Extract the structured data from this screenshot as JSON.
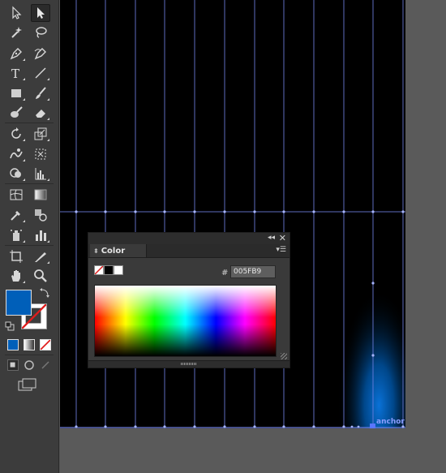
{
  "toolbar": {
    "tools": [
      {
        "name": "selection-tool",
        "selected": false
      },
      {
        "name": "direct-selection-tool",
        "selected": true
      },
      {
        "name": "magic-wand-tool"
      },
      {
        "name": "lasso-tool"
      },
      {
        "name": "pen-tool"
      },
      {
        "name": "curvature-tool"
      },
      {
        "name": "type-tool",
        "glyph": "T"
      },
      {
        "name": "line-segment-tool"
      },
      {
        "name": "rectangle-tool"
      },
      {
        "name": "paintbrush-tool"
      },
      {
        "name": "blob-brush-tool"
      },
      {
        "name": "eraser-tool"
      },
      {
        "name": "rotate-tool"
      },
      {
        "name": "scale-tool"
      },
      {
        "name": "warp-tool"
      },
      {
        "name": "free-transform-tool"
      },
      {
        "name": "shape-builder-tool"
      },
      {
        "name": "perspective-grid-tool"
      },
      {
        "name": "mesh-tool"
      },
      {
        "name": "gradient-tool"
      },
      {
        "name": "eyedropper-tool"
      },
      {
        "name": "blend-tool"
      },
      {
        "name": "symbol-sprayer-tool"
      },
      {
        "name": "column-graph-tool"
      },
      {
        "name": "artboard-tool"
      },
      {
        "name": "slice-tool"
      },
      {
        "name": "hand-tool"
      },
      {
        "name": "zoom-tool"
      }
    ],
    "fill_color": "#005FB9",
    "stroke": "none"
  },
  "color_panel": {
    "tab_label": "Color",
    "hex_label": "#",
    "hex_value": "005FB9"
  },
  "canvas": {
    "anchor_label": "anchor",
    "background": "#000000",
    "guide_color": "#6f7fe0",
    "glow_color": "#005FB9"
  }
}
